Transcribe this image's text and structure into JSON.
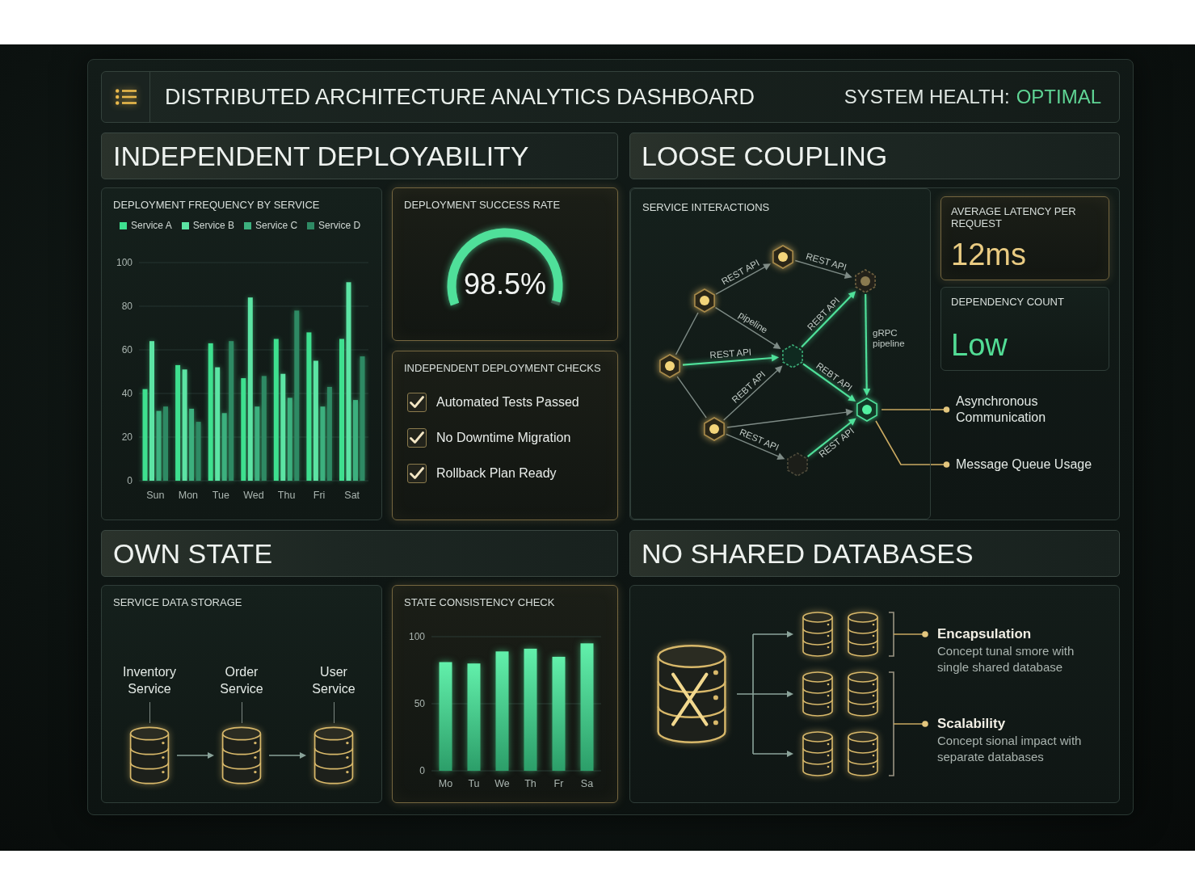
{
  "header": {
    "title": "DISTRIBUTED ARCHITECTURE ANALYTICS DASHBOARD",
    "health_label": "SYSTEM HEALTH:",
    "health_value": "OPTIMAL"
  },
  "independent_deployability": {
    "title": "INDEPENDENT DEPLOYABILITY",
    "frequency_chart": {
      "chart_data": {
        "type": "bar",
        "title": "DEPLOYMENT FREQUENCY BY SERVICE",
        "categories": [
          "Sun",
          "Mon",
          "Tue",
          "Wed",
          "Thu",
          "Fri",
          "Sat"
        ],
        "series": [
          {
            "name": "Service A",
            "color": "#3ee08f",
            "values": [
              42,
              53,
              63,
              47,
              65,
              68,
              65
            ]
          },
          {
            "name": "Service B",
            "color": "#5ce4a4",
            "values": [
              64,
              51,
              52,
              84,
              49,
              55,
              91
            ]
          },
          {
            "name": "Service C",
            "color": "#3cb07e",
            "values": [
              32,
              33,
              31,
              34,
              38,
              34,
              37
            ]
          },
          {
            "name": "Service D",
            "color": "#2e8a64",
            "values": [
              34,
              27,
              64,
              48,
              78,
              43,
              57
            ]
          }
        ],
        "ylim": [
          0,
          100
        ],
        "yticks": [
          0,
          20,
          40,
          60,
          80,
          100
        ],
        "grid": true,
        "legend": "top"
      }
    },
    "success_rate": {
      "title": "DEPLOYMENT SUCCESS RATE",
      "value": "98.5%",
      "level": 0.985
    },
    "checks": {
      "title": "INDEPENDENT DEPLOYMENT CHECKS",
      "items": [
        {
          "label": "Automated Tests Passed",
          "checked": true
        },
        {
          "label": "No Downtime Migration",
          "checked": true
        },
        {
          "label": "Rollback Plan Ready",
          "checked": true
        }
      ]
    }
  },
  "loose_coupling": {
    "title": "LOOSE COUPLING",
    "interactions": {
      "title": "SERVICE INTERACTIONS",
      "edges": [
        {
          "label": "REST API",
          "highlighted": false
        },
        {
          "label": "REST API",
          "highlighted": false
        },
        {
          "label": "pipeline",
          "highlighted": false
        },
        {
          "label": "REST API",
          "highlighted": true
        },
        {
          "label": "REBT API",
          "highlighted": true
        },
        {
          "label": "gRPC pipeline",
          "highlighted": true
        },
        {
          "label": "REBT API",
          "highlighted": true
        },
        {
          "label": "REBT API",
          "highlighted": false
        },
        {
          "highlighted": false
        },
        {
          "label": "REST API",
          "highlighted": false
        },
        {
          "label": "REST API",
          "highlighted": true
        },
        {
          "highlighted": false
        },
        {
          "highlighted": false
        }
      ],
      "outputs": [
        "Asynchronous Communication",
        "Message Queue Usage"
      ]
    },
    "latency": {
      "title": "AVERAGE LATENCY PER REQUEST",
      "value": "12ms"
    },
    "dependency_count": {
      "title": "DEPENDENCY COUNT",
      "value": "Low"
    }
  },
  "own_state": {
    "title": "OWN STATE",
    "storage": {
      "title": "SERVICE DATA STORAGE",
      "services": [
        "Inventory Service",
        "Order Service",
        "User Service"
      ]
    },
    "consistency_chart": {
      "chart_data": {
        "type": "bar",
        "title": "STATE CONSISTENCY CHECK",
        "categories": [
          "Mo",
          "Tu",
          "We",
          "Th",
          "Fr",
          "Sa"
        ],
        "values": [
          81,
          80,
          89,
          91,
          85,
          95
        ],
        "ylim": [
          0,
          100
        ],
        "yticks": [
          0,
          50,
          100
        ],
        "grid": true
      }
    }
  },
  "no_shared_databases": {
    "title": "NO SHARED DATABASES",
    "benefits": [
      {
        "title": "Encapsulation",
        "text": "Concept tunal smore with single shared database"
      },
      {
        "title": "Scalability",
        "text": "Concept sional impact with separate databases"
      }
    ]
  }
}
